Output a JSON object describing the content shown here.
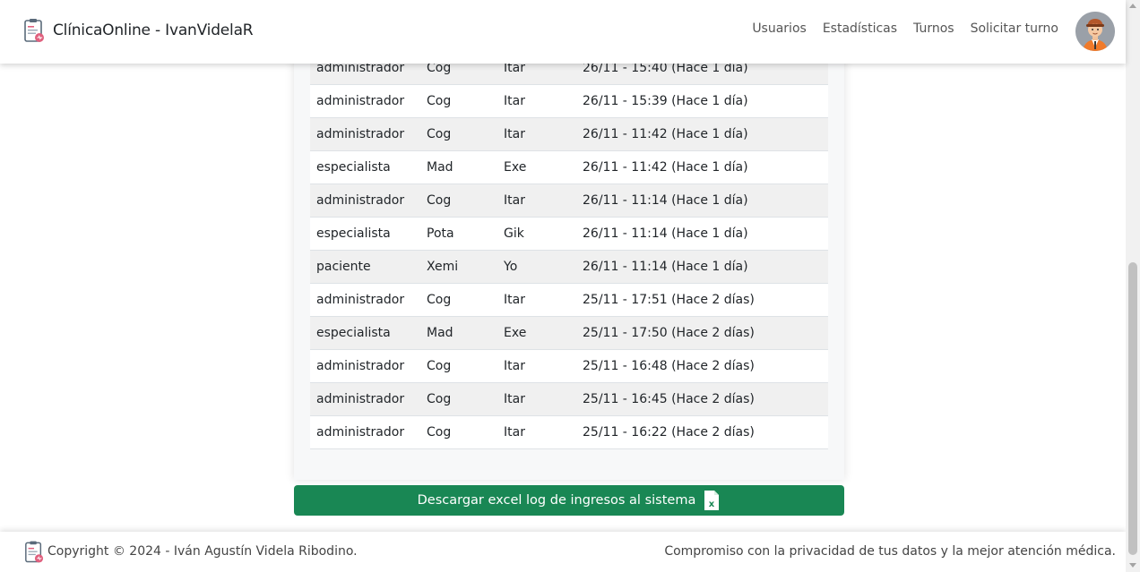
{
  "navbar": {
    "brand": "ClínicaOnline - IvanVidelaR",
    "links": [
      "Usuarios",
      "Estadísticas",
      "Turnos",
      "Solicitar turno"
    ]
  },
  "log_table": {
    "rows": [
      {
        "role": "administrador",
        "name": "Cog",
        "surname": "Itar",
        "date": "26/11 - 15:40 (Hace 1 día)"
      },
      {
        "role": "administrador",
        "name": "Cog",
        "surname": "Itar",
        "date": "26/11 - 15:39 (Hace 1 día)"
      },
      {
        "role": "administrador",
        "name": "Cog",
        "surname": "Itar",
        "date": "26/11 - 11:42 (Hace 1 día)"
      },
      {
        "role": "especialista",
        "name": "Mad",
        "surname": "Exe",
        "date": "26/11 - 11:42 (Hace 1 día)"
      },
      {
        "role": "administrador",
        "name": "Cog",
        "surname": "Itar",
        "date": "26/11 - 11:14 (Hace 1 día)"
      },
      {
        "role": "especialista",
        "name": "Pota",
        "surname": "Gik",
        "date": "26/11 - 11:14 (Hace 1 día)"
      },
      {
        "role": "paciente",
        "name": "Xemi",
        "surname": "Yo",
        "date": "26/11 - 11:14 (Hace 1 día)"
      },
      {
        "role": "administrador",
        "name": "Cog",
        "surname": "Itar",
        "date": "25/11 - 17:51 (Hace 2 días)"
      },
      {
        "role": "especialista",
        "name": "Mad",
        "surname": "Exe",
        "date": "25/11 - 17:50 (Hace 2 días)"
      },
      {
        "role": "administrador",
        "name": "Cog",
        "surname": "Itar",
        "date": "25/11 - 16:48 (Hace 2 días)"
      },
      {
        "role": "administrador",
        "name": "Cog",
        "surname": "Itar",
        "date": "25/11 - 16:45 (Hace 2 días)"
      },
      {
        "role": "administrador",
        "name": "Cog",
        "surname": "Itar",
        "date": "25/11 - 16:22 (Hace 2 días)"
      }
    ]
  },
  "download_button": {
    "label": "Descargar excel log de ingresos al sistema",
    "icon": "excel-file-icon"
  },
  "footer": {
    "copyright": "Copyright © 2024 - Iván Agustín Videla Ribodino.",
    "tagline": "Compromiso con la privacidad de tus datos y la mejor atención médica."
  },
  "colors": {
    "accent_green": "#198754",
    "logo_pink": "#e0607e"
  }
}
